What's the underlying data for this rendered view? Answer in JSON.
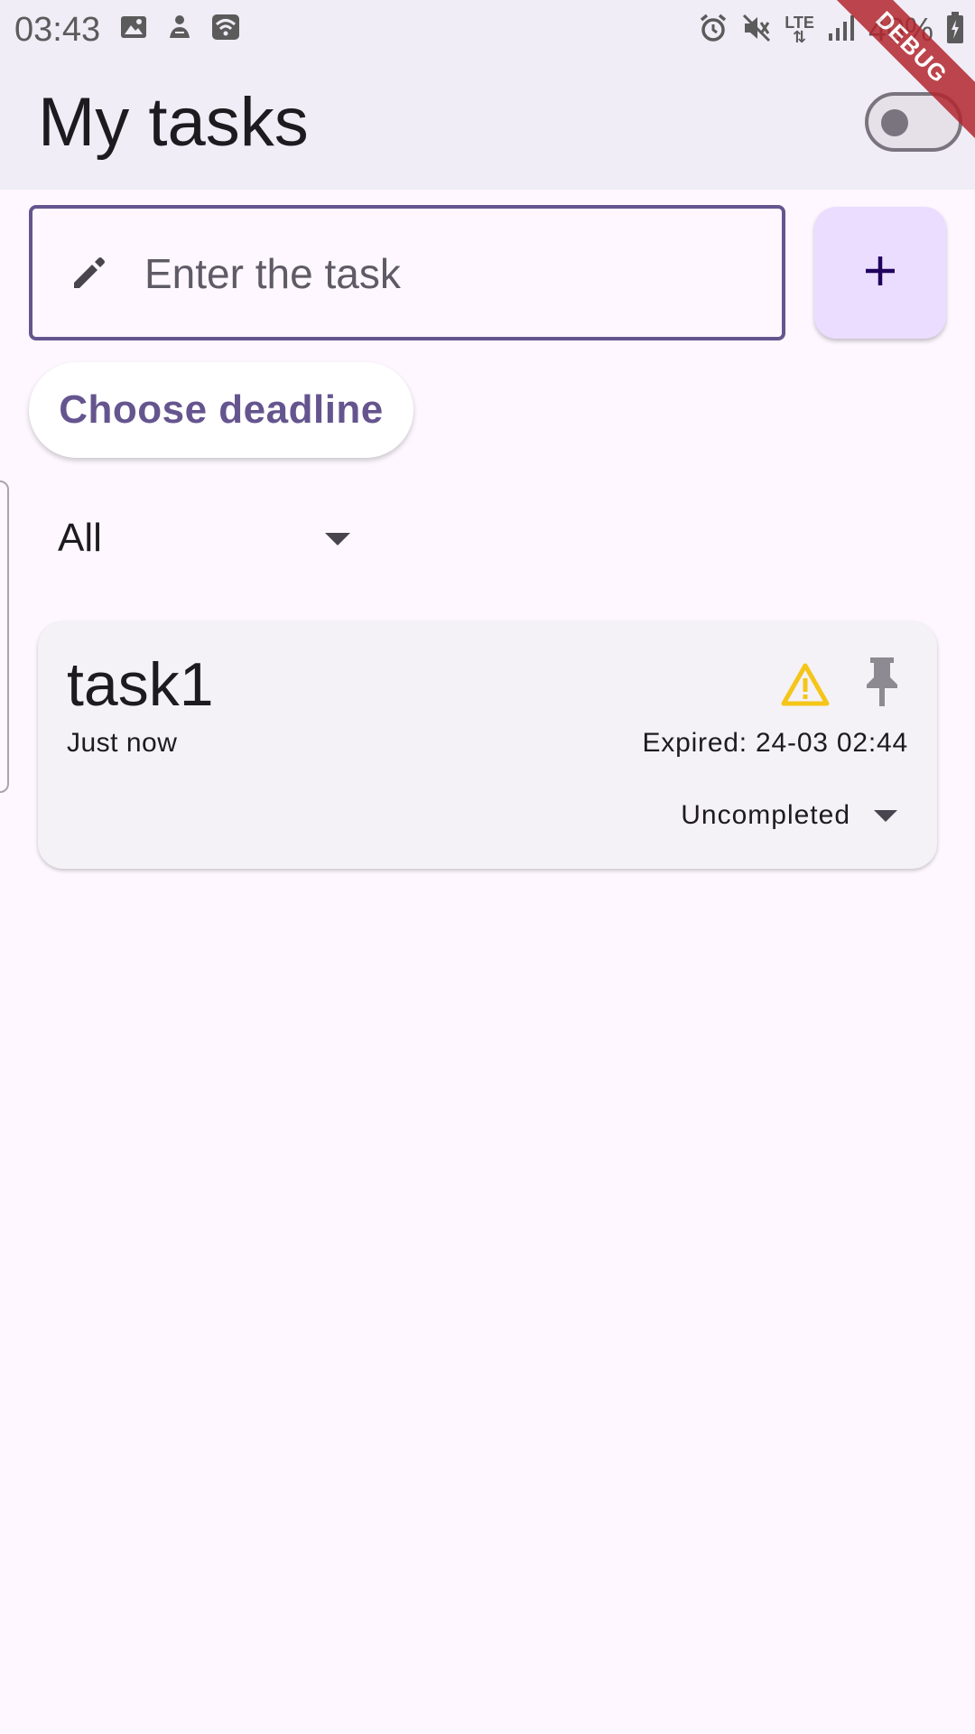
{
  "status_bar": {
    "time": "03:43",
    "battery_percent": "40%",
    "network": "LTE",
    "left_icons": [
      "image-icon",
      "notification-icon",
      "wifi-icon"
    ],
    "right_icons": [
      "alarm-icon",
      "mute-icon",
      "lte-icon",
      "signal-icon",
      "battery-icon"
    ]
  },
  "app_bar": {
    "title": "My tasks",
    "theme_toggle_on": false
  },
  "debug_banner": "DEBUG",
  "task_input": {
    "placeholder": "Enter the task",
    "value": "",
    "icon": "pencil-icon"
  },
  "add_button": {
    "label": "+"
  },
  "deadline_button": {
    "label": "Choose deadline"
  },
  "filter": {
    "selected": "All"
  },
  "tasks": [
    {
      "title": "task1",
      "created": "Just now",
      "expired": "Expired: 24-03 02:44",
      "status": "Uncompleted",
      "icons": [
        "warning-icon",
        "pin-icon"
      ]
    }
  ],
  "colors": {
    "primary": "#65558F",
    "app_bar_bg": "#F0EDF6",
    "background": "#FEF7FF",
    "add_button_bg": "#EADDFF",
    "warning": "#F5C518",
    "debug_ribbon": "#B3272F"
  }
}
